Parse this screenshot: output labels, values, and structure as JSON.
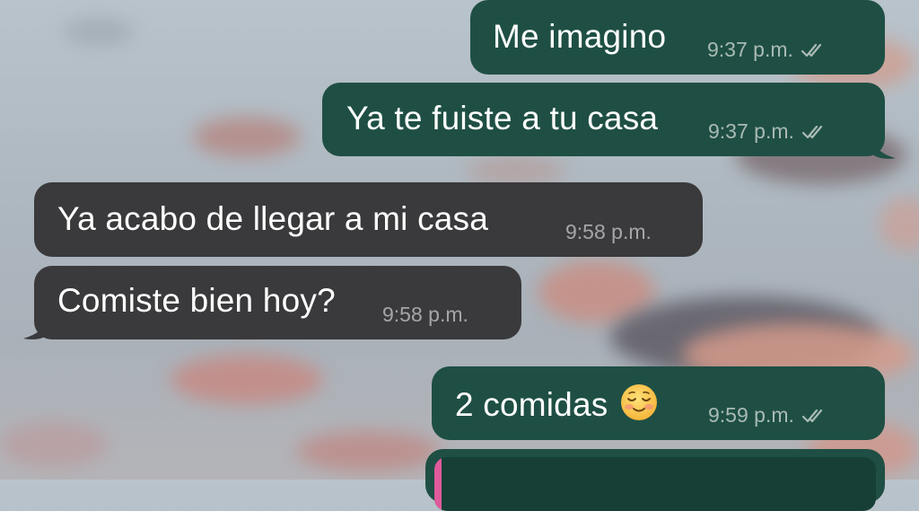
{
  "messages": [
    {
      "direction": "outgoing",
      "text": "Me imagino",
      "time": "9:37 p.m.",
      "status": "read"
    },
    {
      "direction": "outgoing",
      "text": "Ya te fuiste a tu casa",
      "time": "9:37 p.m.",
      "status": "read"
    },
    {
      "direction": "incoming",
      "text": "Ya acabo de llegar a mi casa",
      "time": "9:58 p.m."
    },
    {
      "direction": "incoming",
      "text": "Comiste bien hoy?",
      "time": "9:58 p.m."
    },
    {
      "direction": "outgoing",
      "text": "2 comidas",
      "emoji": "relieved-smiling-face",
      "time": "9:59 p.m.",
      "status": "read"
    },
    {
      "direction": "outgoing",
      "type": "quoted-reply-partial",
      "quote_bar_color": "#e05a9c"
    }
  ],
  "colors": {
    "outgoing_bubble": "#1f4f44",
    "incoming_bubble": "#3a3a3c",
    "text": "#ffffff",
    "meta": "#a9bab4"
  }
}
